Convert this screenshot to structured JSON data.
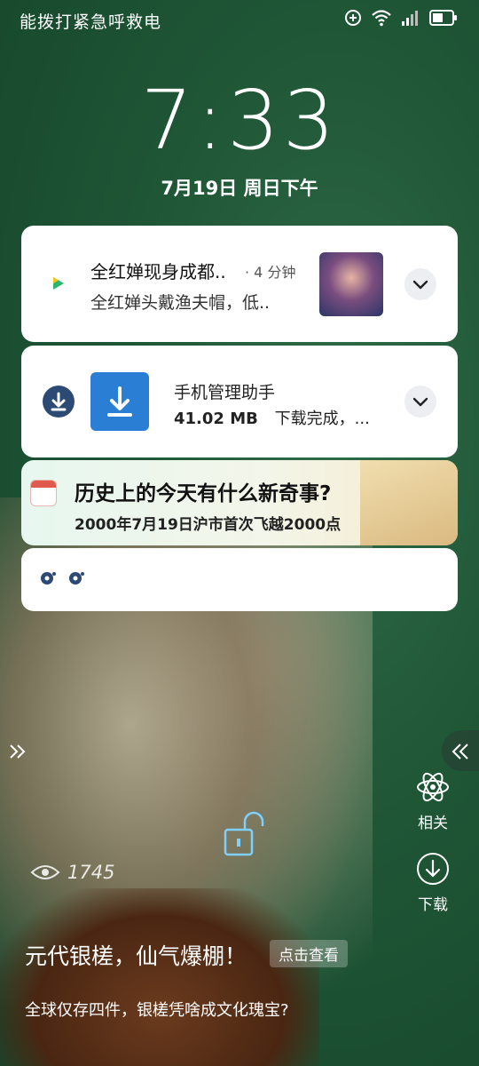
{
  "status_bar": {
    "carrier_text": "能拨打紧急呼救电",
    "icons": [
      "data-saver-icon",
      "wifi-icon",
      "signal-icon",
      "battery-icon"
    ]
  },
  "lock": {
    "time": "7:33",
    "date": "7月19日 周日下午"
  },
  "notifications": [
    {
      "app_icon": "video-app-icon",
      "title": "全红婵现身成都..",
      "time": "· 4 分钟",
      "body": "全红婵头戴渔夫帽，低.."
    },
    {
      "app_icon": "download-icon",
      "title": "手机管理助手",
      "size": "41.02 MB",
      "status": "下载完成，..."
    },
    {
      "app_icon": "calendar-icon",
      "title": "历史上的今天有什么新奇事?",
      "body": "2000年7月19日沪市首次飞越2000点"
    },
    {
      "app_icon": "bubble-icon"
    }
  ],
  "side": {
    "related_label": "相关",
    "download_label": "下载"
  },
  "wallpaper": {
    "views": "1745",
    "title": "元代银槎，仙气爆棚！",
    "view_button": "点击查看",
    "subtitle": "全球仅存四件，银槎凭啥成文化瑰宝?"
  }
}
